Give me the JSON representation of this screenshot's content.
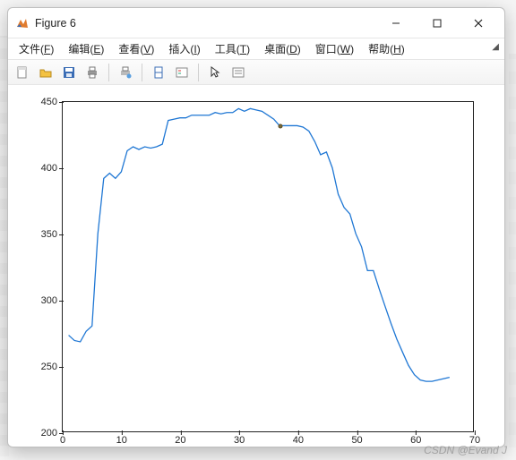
{
  "window": {
    "title": "Figure 6",
    "minimize": "—",
    "maximize": "☐",
    "close": "✕"
  },
  "menu": [
    {
      "label": "文件",
      "mn": "F"
    },
    {
      "label": "编辑",
      "mn": "E"
    },
    {
      "label": "查看",
      "mn": "V"
    },
    {
      "label": "插入",
      "mn": "I"
    },
    {
      "label": "工具",
      "mn": "T"
    },
    {
      "label": "桌面",
      "mn": "D"
    },
    {
      "label": "窗口",
      "mn": "W"
    },
    {
      "label": "帮助",
      "mn": "H"
    }
  ],
  "toolbar_icons": {
    "new": "new-figure-icon",
    "open": "open-folder-icon",
    "save": "save-icon",
    "print": "print-icon",
    "sep1": "",
    "datacursor": "data-cursor-icon",
    "sep2": "",
    "link": "link-axes-icon",
    "legend": "insert-legend-icon",
    "sep3": "",
    "pointer": "pointer-icon",
    "colorbar": "colorbar-icon"
  },
  "chart_data": {
    "type": "line",
    "xlabel": "",
    "ylabel": "",
    "title": "",
    "xlim": [
      0,
      70
    ],
    "ylim": [
      200,
      450
    ],
    "xticks": [
      0,
      10,
      20,
      30,
      40,
      50,
      60,
      70
    ],
    "yticks": [
      200,
      250,
      300,
      350,
      400,
      450
    ],
    "x": [
      1,
      2,
      3,
      4,
      5,
      6,
      7,
      8,
      9,
      10,
      11,
      12,
      13,
      14,
      15,
      16,
      17,
      18,
      19,
      20,
      21,
      22,
      23,
      24,
      25,
      26,
      27,
      28,
      29,
      30,
      31,
      32,
      33,
      34,
      35,
      36,
      37,
      38,
      39,
      40,
      41,
      42,
      43,
      44,
      45,
      46,
      47,
      48,
      49,
      50,
      51,
      52,
      53,
      54,
      55,
      56,
      57,
      58,
      59,
      60,
      61,
      62,
      63,
      64,
      65,
      66
    ],
    "values": [
      273,
      269,
      268,
      276,
      280,
      350,
      392,
      396,
      392,
      397,
      413,
      416,
      414,
      416,
      415,
      416,
      418,
      436,
      437,
      438,
      438,
      440,
      440,
      440,
      440,
      442,
      441,
      442,
      442,
      445,
      443,
      445,
      444,
      443,
      440,
      437,
      432,
      432,
      432,
      432,
      431,
      428,
      420,
      410,
      412,
      400,
      380,
      370,
      365,
      350,
      340,
      322,
      322,
      308,
      295,
      282,
      270,
      260,
      250,
      243,
      239,
      238,
      238,
      239,
      240,
      241
    ],
    "marker": {
      "x": 37,
      "y": 432
    },
    "line_color": "#1f77d4"
  },
  "watermark": "CSDN @Evand J"
}
